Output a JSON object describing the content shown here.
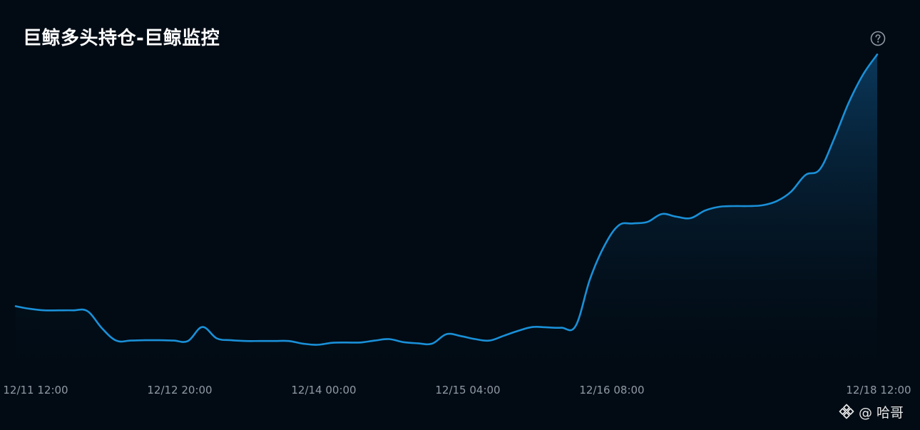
{
  "header": {
    "title": "巨鲸多头持仓-巨鲸监控",
    "help_icon": "question-circle-icon"
  },
  "watermark": {
    "logo_icon": "binance-diamond-icon",
    "handle": "@ 哈哥"
  },
  "colors": {
    "background": "#020b14",
    "line": "#1a90d8",
    "fill_top": "#0b3a5e",
    "fill_bottom": "#020b14",
    "tick_text": "#8f9aa6"
  },
  "chart_data": {
    "type": "area",
    "title": "巨鲸多头持仓-巨鲸监控",
    "xlabel": "",
    "ylabel": "",
    "grid": false,
    "legend": "none",
    "x_tick_labels": [
      "12/11 12:00",
      "12/12 20:00",
      "12/14 00:00",
      "12/15 04:00",
      "12/16 08:00",
      "12/18 12:00"
    ],
    "ylim": [
      0,
      100
    ],
    "series": [
      {
        "values": [
          30.3,
          29.6,
          29.2,
          29.2,
          29.2,
          29.0,
          24.5,
          21.2,
          21.2,
          21.3,
          21.3,
          21.2,
          21.1,
          24.8,
          21.8,
          21.3,
          21.1,
          21.1,
          21.1,
          21.1,
          20.4,
          20.1,
          20.6,
          20.7,
          20.7,
          21.2,
          21.6,
          20.8,
          20.5,
          20.4,
          22.9,
          22.4,
          21.6,
          21.2,
          22.5,
          23.8,
          24.8,
          24.7,
          24.6,
          25.1,
          37.5,
          46.3,
          51.7,
          52.2,
          52.6,
          54.7,
          54.0,
          53.6,
          55.6,
          56.6,
          56.8,
          56.8,
          57.0,
          58.1,
          60.6,
          65.0,
          66.5,
          74.6,
          84.0,
          91.5,
          96.9
        ]
      }
    ]
  }
}
